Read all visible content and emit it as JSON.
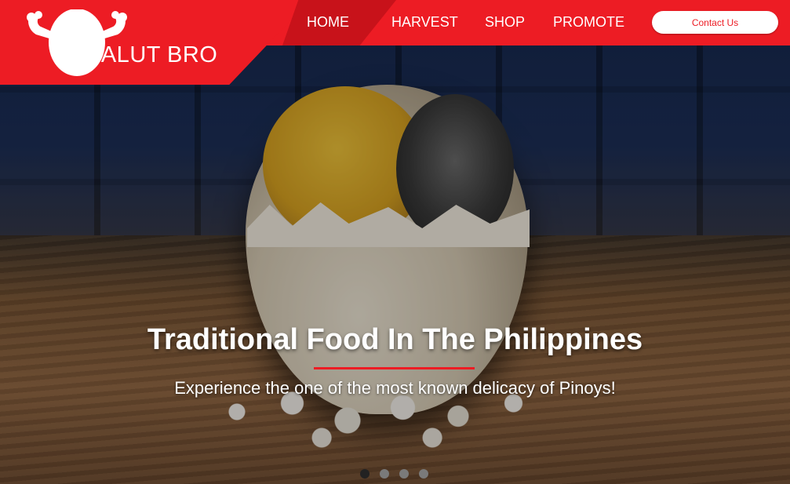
{
  "brand": {
    "name": "BALUT BRO",
    "logo_icon": "strong-egg-icon"
  },
  "nav": {
    "items": [
      {
        "label": "HOME",
        "active": true
      },
      {
        "label": "HARVEST",
        "active": false
      },
      {
        "label": "SHOP",
        "active": false
      },
      {
        "label": "PROMOTE",
        "active": false
      }
    ],
    "contact_label": "Contact Us"
  },
  "hero": {
    "title": "Traditional Food In The Philippines",
    "subtitle": "Experience the one of the most known delicacy of Pinoys!",
    "slide_count": 4,
    "active_slide": 1
  },
  "colors": {
    "brand_red": "#ed1c24",
    "active_tab": "#c8121a",
    "text_white": "#ffffff"
  }
}
